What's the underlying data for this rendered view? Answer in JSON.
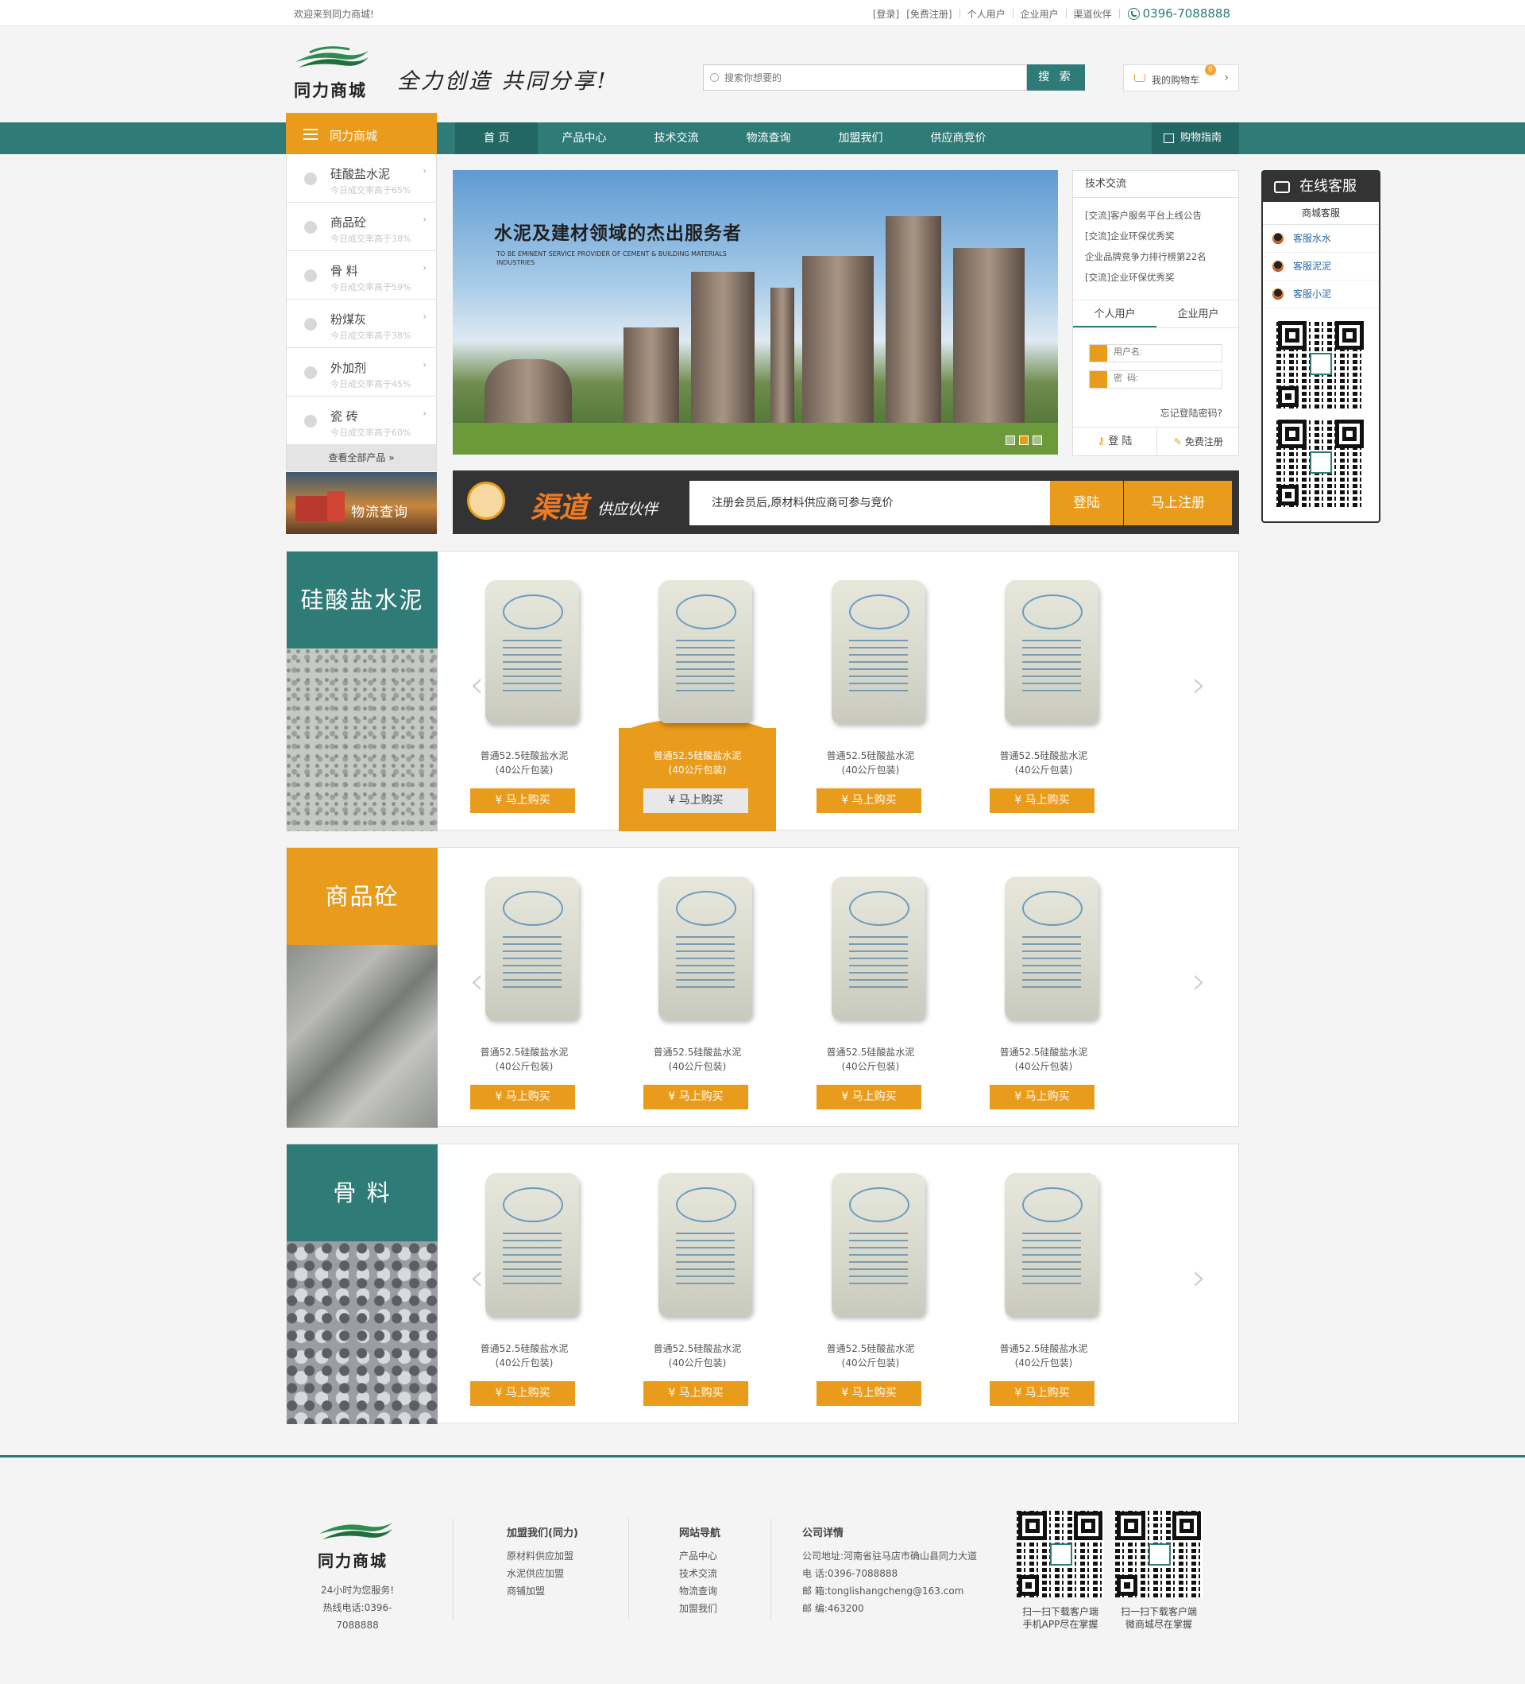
{
  "topbar": {
    "welcome": "欢迎来到同力商城!",
    "login": "[登录]",
    "register": "[免费注册]",
    "personal": "个人用户",
    "enterprise": "企业用户",
    "channel": "渠道伙伴",
    "phone": "0396-7088888"
  },
  "header": {
    "logo_name": "同力商城",
    "slogan": "全力创造 共同分享!",
    "search_placeholder": "搜索你想要的",
    "search_button": "搜 索",
    "cart_label": "我的购物车",
    "cart_count": "0"
  },
  "nav": {
    "category_head": "同力商城",
    "items": [
      {
        "label": "首 页",
        "active": true
      },
      {
        "label": "产品中心"
      },
      {
        "label": "技术交流"
      },
      {
        "label": "物流查询"
      },
      {
        "label": "加盟我们"
      },
      {
        "label": "供应商竞价"
      }
    ],
    "guide": "购物指南"
  },
  "categories": [
    {
      "name": "硅酸盐水泥",
      "sub": "今日成交率高于65%",
      "icon": "gear-icon"
    },
    {
      "name": "商品砼",
      "sub": "今日成交率高于38%",
      "icon": "cloud-icon"
    },
    {
      "name": "骨 料",
      "sub": "今日成交率高于59%",
      "icon": "bell-icon"
    },
    {
      "name": "粉煤灰",
      "sub": "今日成交率高于38%",
      "icon": "at-icon"
    },
    {
      "name": "外加剂",
      "sub": "今日成交率高于45%",
      "icon": "network-icon"
    },
    {
      "name": "瓷 砖",
      "sub": "今日成交率高于60%",
      "icon": "layers-icon"
    }
  ],
  "all_products": "查看全部产品 »",
  "logistics": "物流查询",
  "banner": {
    "title": "水泥及建材领域的杰出服务者",
    "subtitle": "TO BE EMINENT SERVICE PROVIDER OF CEMENT & BUILDING MATERIALS INDUSTRIES"
  },
  "news": {
    "title": "技术交流",
    "items": [
      "[交流]客户服务平台上线公告",
      "[交流]企业环保优秀奖",
      "企业品牌竞争力排行榜第22名",
      "[交流]企业环保优秀奖"
    ]
  },
  "login": {
    "tab_personal": "个人用户",
    "tab_enterprise": "企业用户",
    "username_placeholder": "用户名:",
    "password_placeholder": "密  码:",
    "forgot": "忘记登陆密码?",
    "login_btn": "登 陆",
    "register_btn": "免费注册"
  },
  "channel": {
    "big": "渠道",
    "small": "供应伙伴",
    "message": "注册会员后,原材料供应商可参与竞价",
    "login": "登陆",
    "register": "马上注册"
  },
  "service": {
    "title": "在线客服",
    "subtitle": "商城客服",
    "agents": [
      "客服水水",
      "客服泥泥",
      "客服小泥"
    ]
  },
  "sections": [
    {
      "title": "硅酸盐水泥",
      "color": "#2f7b77",
      "products": [
        {
          "name": "普通52.5硅酸盐水泥",
          "pack": "(40公斤包装)",
          "buy": "¥ 马上购买"
        },
        {
          "name": "普通52.5硅酸盐水泥",
          "pack": "(40公斤包装)",
          "buy": "¥ 马上购买",
          "highlight": true
        },
        {
          "name": "普通52.5硅酸盐水泥",
          "pack": "(40公斤包装)",
          "buy": "¥ 马上购买"
        },
        {
          "name": "普通52.5硅酸盐水泥",
          "pack": "(40公斤包装)",
          "buy": "¥ 马上购买"
        }
      ]
    },
    {
      "title": "商品砼",
      "color": "#e99b1b",
      "products": [
        {
          "name": "普通52.5硅酸盐水泥",
          "pack": "(40公斤包装)",
          "buy": "¥ 马上购买"
        },
        {
          "name": "普通52.5硅酸盐水泥",
          "pack": "(40公斤包装)",
          "buy": "¥ 马上购买"
        },
        {
          "name": "普通52.5硅酸盐水泥",
          "pack": "(40公斤包装)",
          "buy": "¥ 马上购买"
        },
        {
          "name": "普通52.5硅酸盐水泥",
          "pack": "(40公斤包装)",
          "buy": "¥ 马上购买"
        }
      ]
    },
    {
      "title": "骨 料",
      "color": "#2f7b77",
      "products": [
        {
          "name": "普通52.5硅酸盐水泥",
          "pack": "(40公斤包装)",
          "buy": "¥ 马上购买"
        },
        {
          "name": "普通52.5硅酸盐水泥",
          "pack": "(40公斤包装)",
          "buy": "¥ 马上购买"
        },
        {
          "name": "普通52.5硅酸盐水泥",
          "pack": "(40公斤包装)",
          "buy": "¥ 马上购买"
        },
        {
          "name": "普通52.5硅酸盐水泥",
          "pack": "(40公斤包装)",
          "buy": "¥ 马上购买"
        }
      ]
    }
  ],
  "footer": {
    "logo_name": "同力商城",
    "service_hours": "24小时为您服务!",
    "hotline": "热线电话:0396-7088888",
    "join": {
      "title": "加盟我们(同力)",
      "links": [
        "原材料供应加盟",
        "水泥供应加盟",
        "商铺加盟"
      ]
    },
    "sitenav": {
      "title": "网站导航",
      "links": [
        "产品中心",
        "技术交流",
        "物流查询",
        "加盟我们"
      ]
    },
    "company": {
      "title": "公司详情",
      "lines": [
        "公司地址:河南省驻马店市确山县同力大道",
        "电 话:0396-7088888",
        "邮 箱:tonglishangcheng@163.com",
        "邮 编:463200"
      ]
    },
    "qr1": [
      "扫一扫下载客户端",
      "手机APP尽在掌握"
    ],
    "qr2": [
      "扫一扫下载客户端",
      "微商城尽在掌握"
    ]
  },
  "colors": {
    "teal": "#2f7b77",
    "orange": "#e99b1b"
  }
}
